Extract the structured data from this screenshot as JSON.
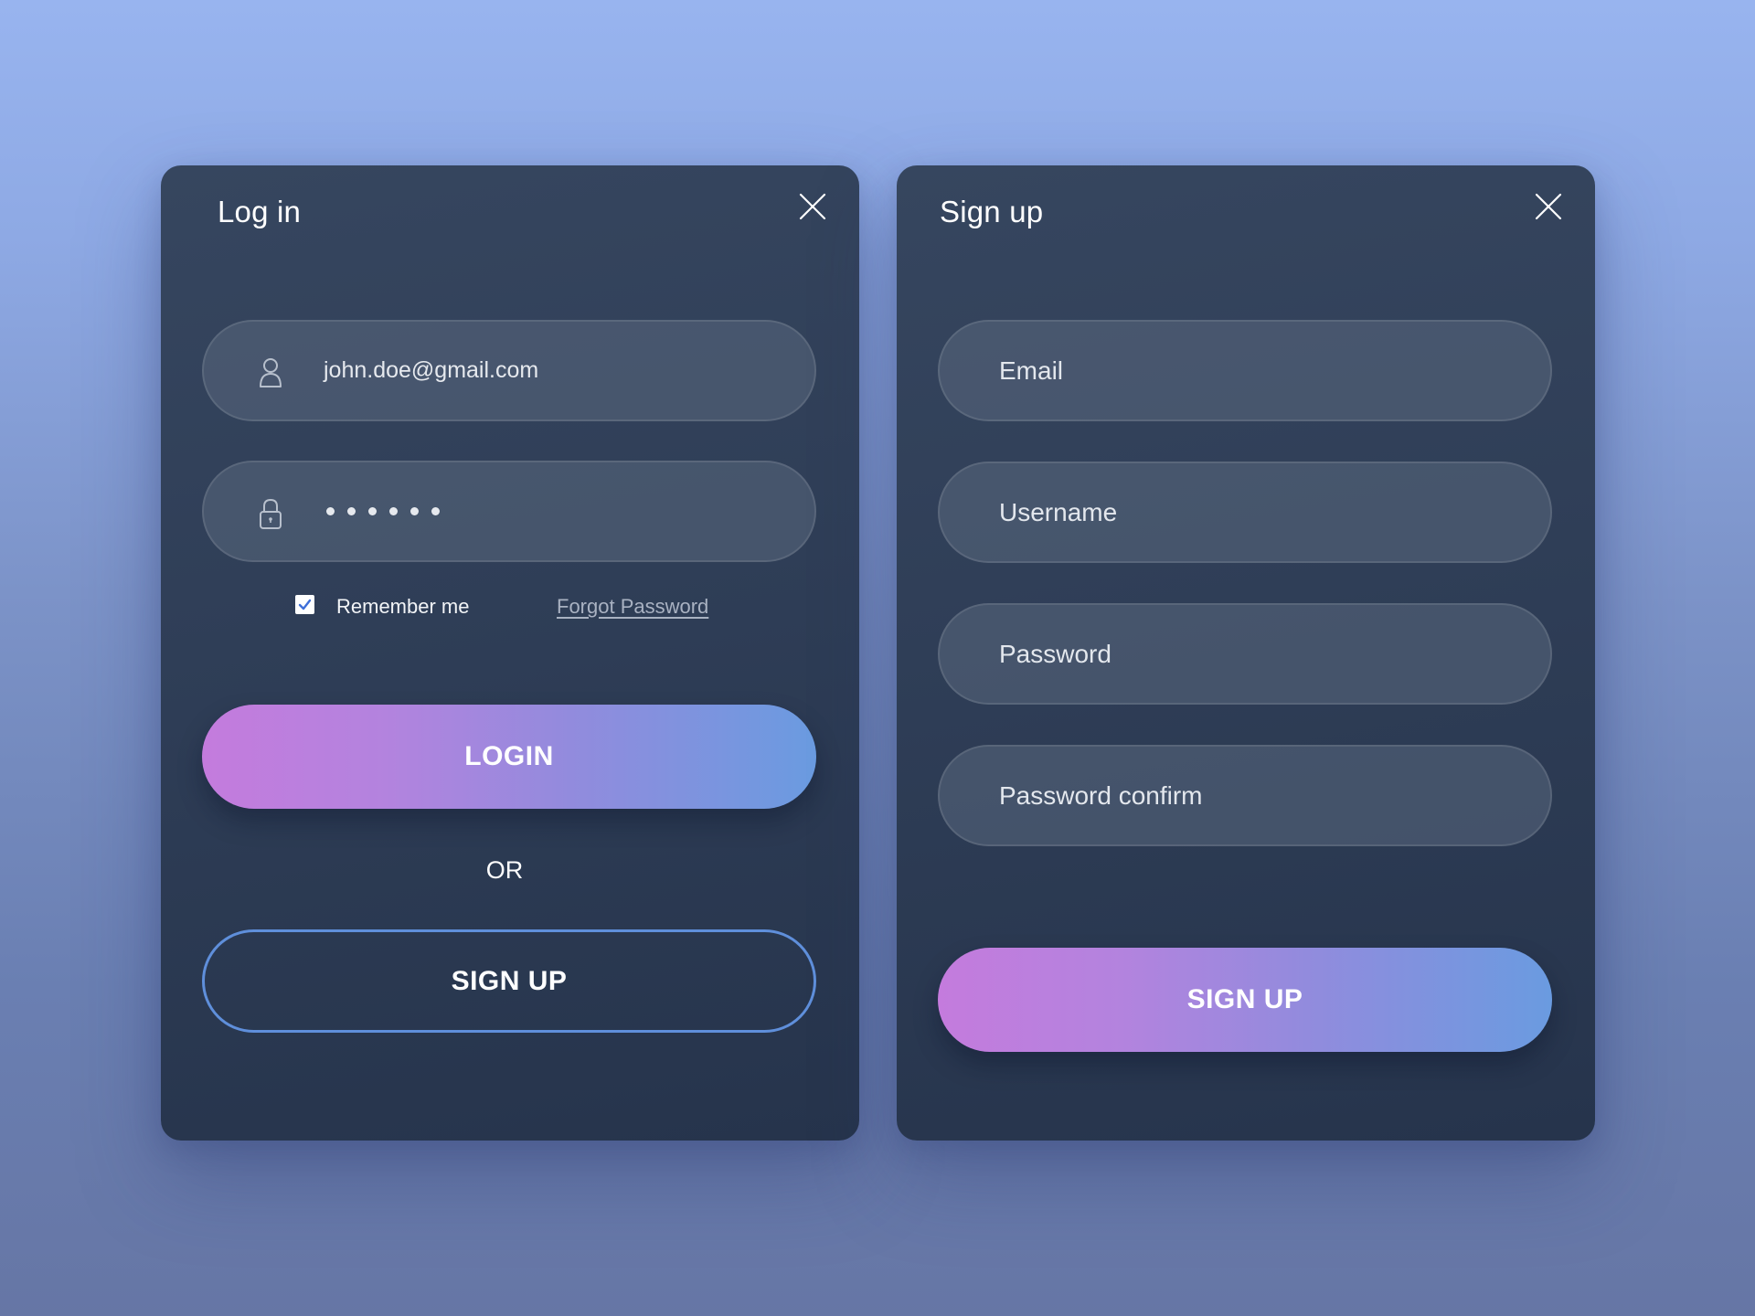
{
  "colors": {
    "gradient_start": "#c47bdd",
    "gradient_end": "#6a9be0",
    "outline_border": "#5f8fdb",
    "panel_bg": "#2f3e57"
  },
  "login": {
    "title": "Log in",
    "close_icon": "close-icon",
    "email_field": {
      "icon": "user-icon",
      "value": "john.doe@gmail.com"
    },
    "password_field": {
      "icon": "lock-icon",
      "masked_length": 6
    },
    "remember_me": {
      "label": "Remember me",
      "checked": true
    },
    "forgot_password": "Forgot Password",
    "login_button": "LOGIN",
    "or_text": "OR",
    "signup_button": "SIGN UP"
  },
  "signup": {
    "title": "Sign up",
    "close_icon": "close-icon",
    "fields": [
      {
        "placeholder": "Email"
      },
      {
        "placeholder": "Username"
      },
      {
        "placeholder": "Password"
      },
      {
        "placeholder": "Password confirm"
      }
    ],
    "signup_button": "SIGN UP"
  }
}
